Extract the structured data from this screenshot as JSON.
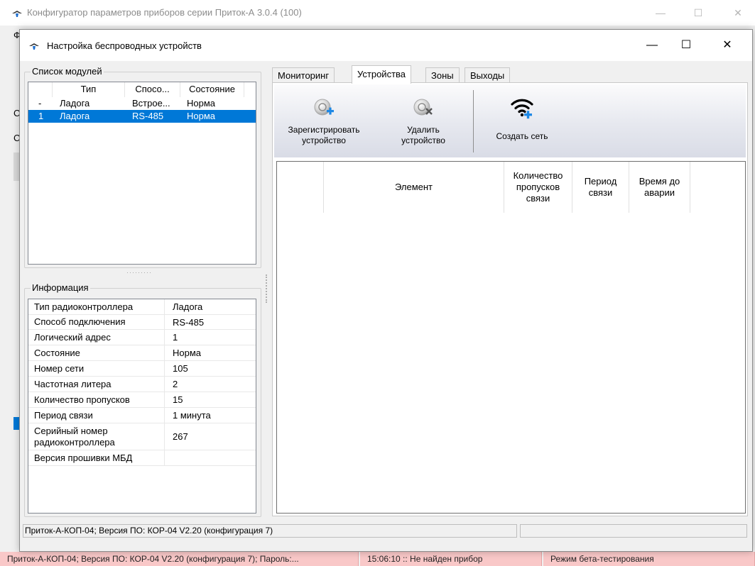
{
  "main_window": {
    "title": "Конфигуратор параметров приборов серии Приток-А  3.0.4 (100)",
    "minimize_icon": "minimize-icon",
    "maximize_icon": "maximize-icon",
    "close_icon": "close-icon",
    "bg_letters": [
      "Ф",
      "С",
      "С"
    ],
    "status_segments": [
      "Приток-А-КОП-04; Версия ПО: КОР-04 V2.20 (конфигурация 7); Пароль:...",
      "15:06:10 :: Не найден прибор",
      "Режим бета-тестирования"
    ],
    "status_color": "#f9c8c8"
  },
  "dialog": {
    "title": "Настройка беспроводных устройств",
    "app_icon": "app-logo-icon",
    "minimize_glyph": "—",
    "maximize_glyph": "☐",
    "close_glyph": "✕"
  },
  "modules": {
    "group_label": "Список модулей",
    "columns": [
      "",
      "Тип",
      "Спосо...",
      "Состояние"
    ],
    "rows": [
      {
        "index": "-",
        "type": "Ладога",
        "connection": "Встрое...",
        "state": "Норма",
        "selected": false
      },
      {
        "index": "1",
        "type": "Ладога",
        "connection": "RS-485",
        "state": "Норма",
        "selected": true
      }
    ],
    "selection_color": "#0078d7"
  },
  "info": {
    "group_label": "Информация",
    "rows": [
      {
        "name": "Тип радиоконтроллера",
        "value": "Ладога"
      },
      {
        "name": "Способ подключения",
        "value": "RS-485"
      },
      {
        "name": "Логический адрес",
        "value": "1"
      },
      {
        "name": "Состояние",
        "value": "Норма"
      },
      {
        "name": "Номер сети",
        "value": "105"
      },
      {
        "name": "Частотная литера",
        "value": "2"
      },
      {
        "name": "Количество пропусков",
        "value": "15"
      },
      {
        "name": "Период связи",
        "value": "1 минута"
      },
      {
        "name": "Серийный номер радиоконтроллера",
        "value": "267"
      },
      {
        "name": "Версия прошивки МБД",
        "value": ""
      }
    ]
  },
  "tabs": [
    {
      "label": "Мониторинг",
      "active": false
    },
    {
      "label": "Устройства",
      "active": true
    },
    {
      "label": "Зоны",
      "active": false
    },
    {
      "label": "Выходы",
      "active": false
    }
  ],
  "toolbar": {
    "register_label": "Зарегистрировать устройство",
    "register_icon": "register-device-icon",
    "delete_label": "Удалить устройство",
    "delete_icon": "delete-device-icon",
    "create_network_label": "Создать сеть",
    "create_network_icon": "wifi-add-icon",
    "accent_color": "#1e88e5"
  },
  "devices_table": {
    "columns": [
      "",
      "Элемент",
      "Количество пропусков связи",
      "Период связи",
      "Время до аварии",
      ""
    ],
    "rows": []
  },
  "dialog_status": {
    "text": "Приток-А-КОП-04; Версия ПО: КОР-04 V2.20 (конфигурация 7)",
    "second": ""
  }
}
